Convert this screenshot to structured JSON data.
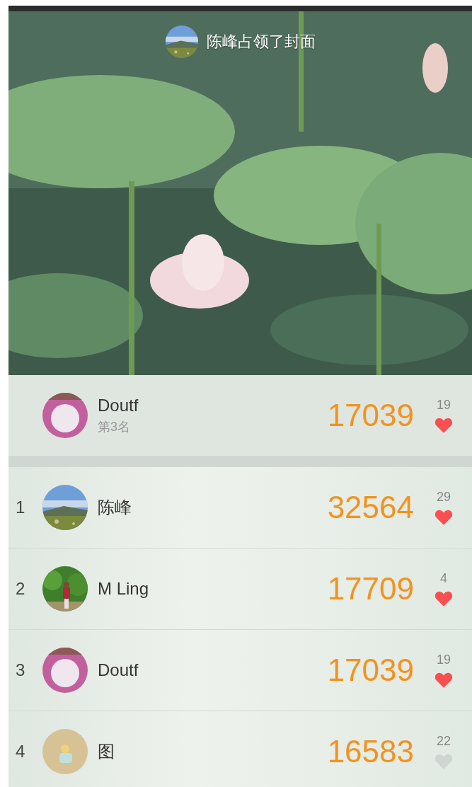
{
  "cover": {
    "kind": "picture",
    "caption": "陈峰占领了封面",
    "avatar": {
      "kind": "landscape"
    }
  },
  "me": {
    "name": "Doutf",
    "rank_label": "第3名",
    "avatar": {
      "kind": "plain-pink"
    },
    "steps": "17039",
    "likes": "19",
    "liked": true
  },
  "ranking": [
    {
      "rank": "1",
      "name": "陈峰",
      "avatar": {
        "kind": "landscape"
      },
      "steps": "32564",
      "likes": "29",
      "liked": true
    },
    {
      "rank": "2",
      "name": "M  Ling",
      "avatar": {
        "kind": "greenery"
      },
      "steps": "17709",
      "likes": "4",
      "liked": true
    },
    {
      "rank": "3",
      "name": "Doutf",
      "avatar": {
        "kind": "plain-pink"
      },
      "steps": "17039",
      "likes": "19",
      "liked": true
    },
    {
      "rank": "4",
      "name": "图",
      "avatar": {
        "kind": "plain-tan"
      },
      "steps": "16583",
      "likes": "22",
      "liked": false
    }
  ]
}
